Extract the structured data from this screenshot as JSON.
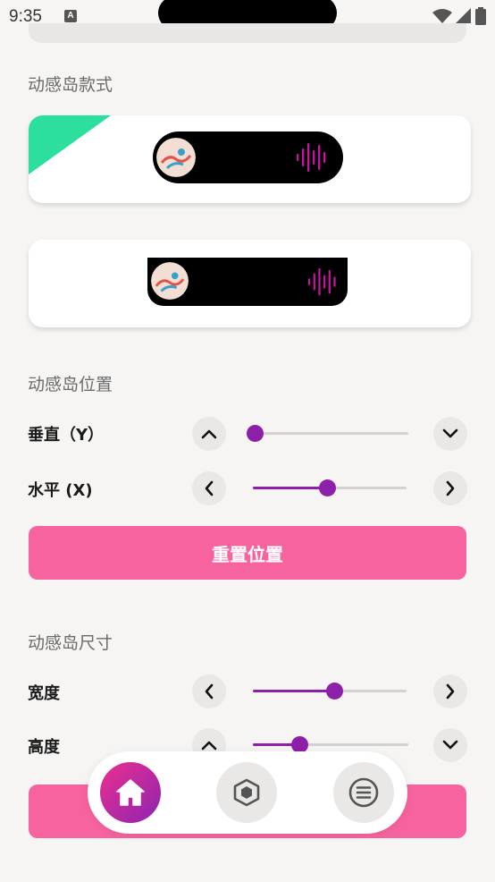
{
  "status_bar": {
    "time": "9:35",
    "notification_icon": "A"
  },
  "sections": {
    "style_title": "动感岛款式",
    "position_title": "动感岛位置",
    "size_title": "动感岛尺寸"
  },
  "position": {
    "vertical_label": "垂直（Y）",
    "horizontal_label": "水平 (X)",
    "vertical_value": 0,
    "horizontal_value": 0.48,
    "reset_label": "重置位置"
  },
  "size": {
    "width_label": "宽度",
    "height_label": "高度",
    "width_value": 0.53,
    "height_value": 0.3
  },
  "colors": {
    "accent": "#8e1fa8",
    "pink": "#f7639f",
    "selected": "#2cdf9c"
  },
  "nav": {
    "items": [
      "home-icon",
      "cube-icon",
      "menu-icon"
    ]
  }
}
